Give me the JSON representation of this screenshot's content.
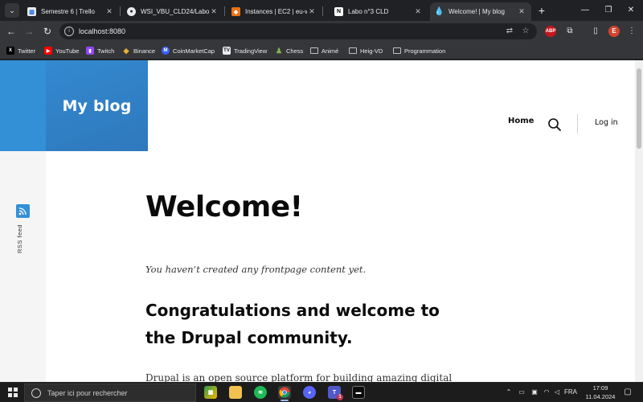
{
  "browser": {
    "tabs": [
      {
        "title": "Semestre 6 | Trello",
        "icon": "trello-icon",
        "color": "#0c66e4"
      },
      {
        "title": "WSI_VBU_CLD24/Labo03",
        "icon": "github-icon",
        "color": "#ffffff"
      },
      {
        "title": "Instances | EC2 | eu-west",
        "icon": "aws-icon",
        "color": "#ec7211"
      },
      {
        "title": "Labo n°3 CLD",
        "icon": "notion-icon",
        "color": "#ffffff"
      },
      {
        "title": "Welcome! | My blog",
        "icon": "drupal-icon",
        "color": "#2f8ed6",
        "active": true
      }
    ],
    "url": "localhost:8080",
    "profile_initial": "E",
    "adblock_label": "ABP",
    "bookmarks": [
      {
        "label": "Twitter",
        "icon": "x-icon",
        "color": "#000000"
      },
      {
        "label": "YouTube",
        "icon": "youtube-icon",
        "color": "#ff0000"
      },
      {
        "label": "Twitch",
        "icon": "twitch-icon",
        "color": "#9146ff"
      },
      {
        "label": "Binance",
        "icon": "binance-icon",
        "color": "#f3ba2f"
      },
      {
        "label": "CoinMarketCap",
        "icon": "coinmarketcap-icon",
        "color": "#3861fb"
      },
      {
        "label": "TradingView",
        "icon": "tradingview-icon",
        "color": "#131722"
      },
      {
        "label": "Chess",
        "icon": "chess-icon",
        "color": "#81b64c"
      },
      {
        "label": "Animé",
        "icon": "folder-icon"
      },
      {
        "label": "Heig-VD",
        "icon": "folder-icon"
      },
      {
        "label": "Programmation",
        "icon": "folder-icon"
      }
    ]
  },
  "site": {
    "name": "My blog",
    "nav_home": "Home",
    "login": "Log in",
    "rss_label": "RSS feed",
    "accent_color": "#338fd6"
  },
  "content": {
    "title": "Welcome!",
    "empty_message": "You haven’t created any frontpage content yet.",
    "congrats_heading": "Congratulations and welcome to the Drupal community.",
    "intro": "Drupal is an open source platform for building amazing digital"
  },
  "taskbar": {
    "search_placeholder": "Taper ici pour rechercher",
    "language": "FRA",
    "time": "17:09",
    "date": "11.04.2024",
    "teams_badge": "1"
  }
}
